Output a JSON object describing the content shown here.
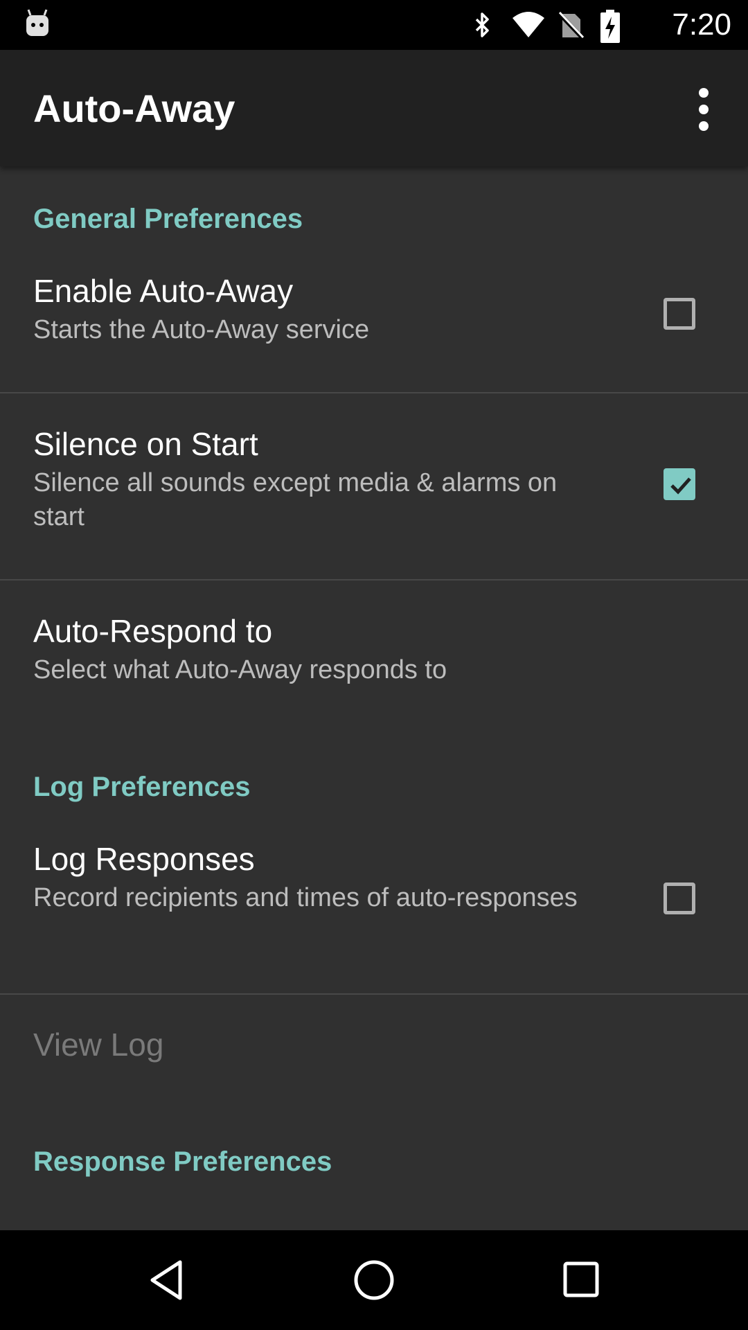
{
  "status_bar": {
    "time": "7:20",
    "icons": [
      "android-icon",
      "bluetooth-icon",
      "wifi-icon",
      "no-sim-icon",
      "battery-charging-icon"
    ]
  },
  "app_bar": {
    "title": "Auto-Away",
    "overflow_icon": "more-vert-icon"
  },
  "categories": {
    "general": "General Preferences",
    "log": "Log Preferences",
    "response": "Response Preferences"
  },
  "prefs": {
    "enable": {
      "title": "Enable Auto-Away",
      "summary": "Starts the Auto-Away service",
      "checked": false
    },
    "silence": {
      "title": "Silence on Start",
      "summary": "Silence all sounds except media & alarms on start",
      "checked": true
    },
    "respond": {
      "title": "Auto-Respond to",
      "summary": "Select what Auto-Away responds to"
    },
    "log_responses": {
      "title": "Log Responses",
      "summary": "Record recipients and times of auto-responses",
      "checked": false
    },
    "view_log": {
      "title": "View Log",
      "enabled": false
    }
  },
  "nav_bar": {
    "icons": [
      "back-icon",
      "home-icon",
      "recents-icon"
    ]
  },
  "colors": {
    "accent": "#80cbc4",
    "background": "#303030",
    "app_bar": "#212121"
  }
}
